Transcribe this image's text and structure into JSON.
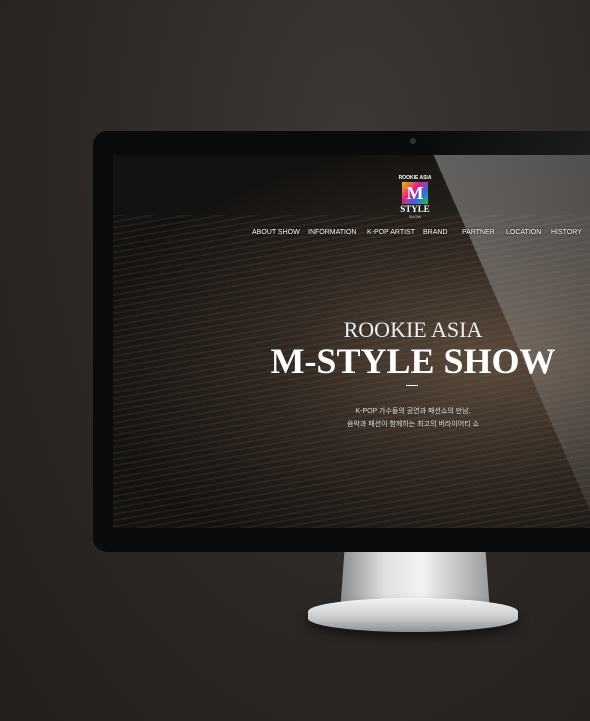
{
  "logo": {
    "top_text": "ROOKIE ASIA",
    "letter": "M",
    "style": "STYLE",
    "show": "SHOW"
  },
  "nav": [
    "ABOUT SHOW",
    "INFORMATION",
    "K-POP ARTIST",
    "BRAND",
    "PARTNER",
    "LOCATION",
    "HISTORY"
  ],
  "hero": {
    "title_small": "ROOKIE ASIA",
    "title_large": "M-STYLE SHOW",
    "line1": "K-POP 가수들의 공연과 패션쇼의 만남,",
    "line2": "음악과 패션이 함께하는 최고의 버라이어티 쇼"
  }
}
